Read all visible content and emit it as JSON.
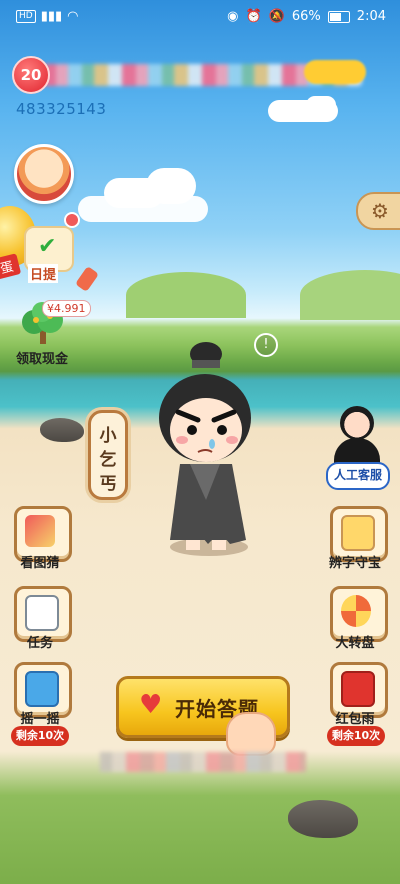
{
  "status_bar": {
    "left_badge": "HD",
    "battery_text": "66%",
    "time": "2:04"
  },
  "header": {
    "level_badge": "20",
    "user_id": "483325143"
  },
  "left_column": {
    "gold_egg_label": "蛋",
    "task_label": "日提",
    "money_tag": "¥4.991",
    "cash_label": "领取现金"
  },
  "character": {
    "name_sign": [
      "小",
      "乞",
      "丐"
    ]
  },
  "agent": {
    "label": "人工客服"
  },
  "side_buttons": {
    "left": [
      {
        "label": "看图猜",
        "icon": "photo-guess-icon"
      },
      {
        "label": "任务",
        "icon": "clipboard-icon"
      },
      {
        "label": "摇一摇",
        "icon": "phone-shake-icon",
        "remaining": "剩余10次"
      }
    ],
    "right": [
      {
        "label": "辨字守宝",
        "icon": "character-puzzle-icon"
      },
      {
        "label": "大转盘",
        "icon": "wheel-icon"
      },
      {
        "label": "红包雨",
        "icon": "red-envelope-icon",
        "remaining": "剩余10次"
      }
    ]
  },
  "start_button": {
    "label": "开始答题"
  },
  "colors": {
    "accent_gold": "#f7c51e",
    "badge_red": "#d6301f",
    "agent_blue": "#2b66c7"
  }
}
